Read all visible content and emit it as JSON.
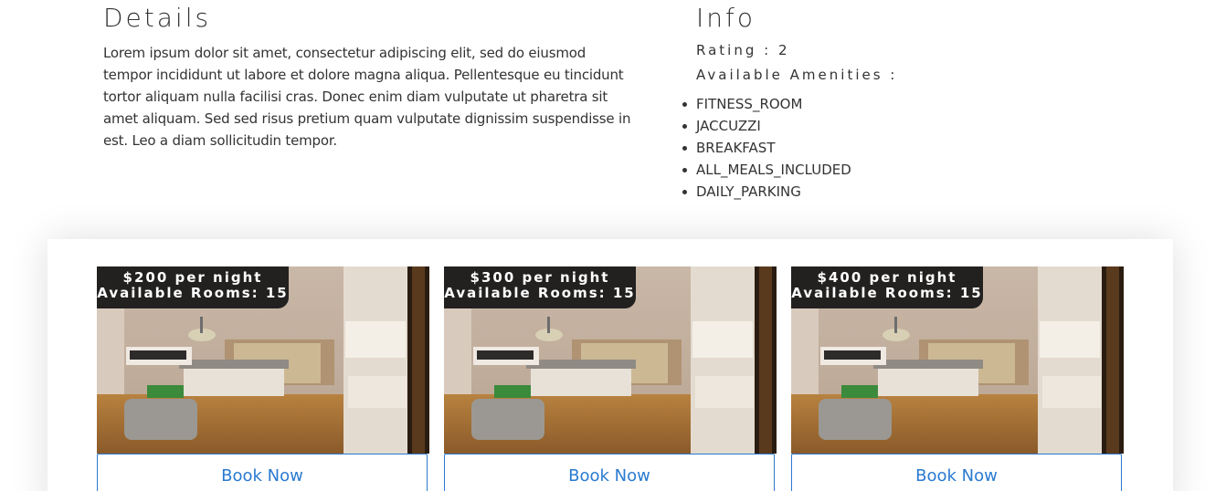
{
  "details": {
    "title": "Details",
    "description": "Lorem ipsum dolor sit amet, consectetur adipiscing elit, sed do eiusmod tempor incididunt ut labore et dolore magna aliqua. Pellentesque eu tincidunt tortor aliquam nulla facilisi cras. Donec enim diam vulputate ut pharetra sit amet aliquam. Sed sed risus pretium quam vulputate dignissim suspendisse in est. Leo a diam sollicitudin tempor."
  },
  "info": {
    "title": "Info",
    "rating_label": "Rating : 2",
    "amenities_label": "Available Amenities :",
    "amenities": [
      "FITNESS_ROOM",
      "JACCUZZI",
      "BREAKFAST",
      "ALL_MEALS_INCLUDED",
      "DAILY_PARKING"
    ]
  },
  "rooms": [
    {
      "price": "$200 per night",
      "availability": "Available Rooms: 15",
      "button_label": "Book Now"
    },
    {
      "price": "$300 per night",
      "availability": "Available Rooms: 15",
      "button_label": "Book Now"
    },
    {
      "price": "$400 per night",
      "availability": "Available Rooms: 15",
      "button_label": "Book Now"
    }
  ],
  "colors": {
    "accent": "#2a7ad1",
    "tag_background": "#222120",
    "text": "#333333"
  }
}
